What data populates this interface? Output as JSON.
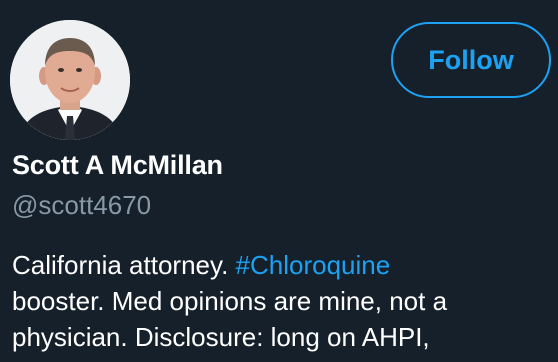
{
  "profile": {
    "follow_label": "Follow",
    "display_name": "Scott A McMillan",
    "handle": "@scott4670",
    "bio": {
      "line1_prefix": "California attorney. ",
      "hashtag": "#Chloroquine",
      "line2": "booster. Med opinions are mine, not a",
      "line3": "physician. Disclosure: long on AHPI,"
    }
  },
  "colors": {
    "background": "#15202b",
    "accent": "#1da1f2",
    "text_primary": "#ffffff",
    "text_secondary": "#8899a6"
  },
  "icons": {
    "avatar": "profile-photo"
  }
}
